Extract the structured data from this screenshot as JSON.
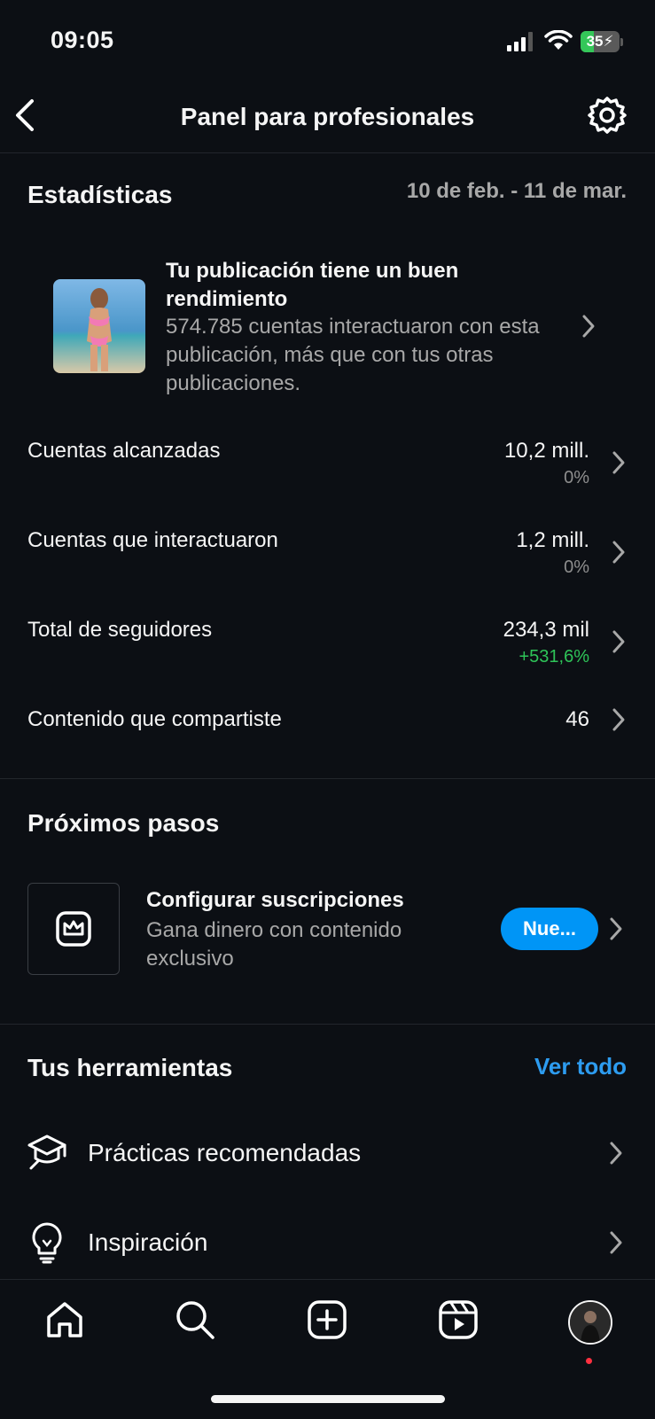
{
  "status_bar": {
    "time": "09:05",
    "battery": "35",
    "battery_level": 0.35
  },
  "header": {
    "title": "Panel para profesionales"
  },
  "stats": {
    "heading": "Estadísticas",
    "date_range": "10 de feb. - 11 de mar.",
    "featured_post": {
      "title": "Tu publicación tiene un buen rendimiento",
      "description": "574.785 cuentas interactuaron con esta publicación, más que con tus otras publicaciones."
    },
    "rows": [
      {
        "label": "Cuentas alcanzadas",
        "value": "10,2 mill.",
        "change": "0%"
      },
      {
        "label": "Cuentas que interactuaron",
        "value": "1,2 mill.",
        "change": "0%"
      },
      {
        "label": "Total de seguidores",
        "value": "234,3 mil",
        "change": "+531,6%"
      },
      {
        "label": "Contenido que compartiste",
        "value": "46"
      }
    ]
  },
  "next_steps": {
    "heading": "Próximos pasos",
    "card": {
      "title": "Configurar suscripciones",
      "description": "Gana dinero con contenido exclusivo",
      "badge": "Nue..."
    }
  },
  "tools": {
    "heading": "Tus herramientas",
    "see_all": "Ver todo",
    "items": [
      {
        "label": "Prácticas recomendadas",
        "icon": "graduation-cap-icon"
      },
      {
        "label": "Inspiración",
        "icon": "lightbulb-icon"
      }
    ]
  },
  "nav": {
    "items": [
      "home-icon",
      "search-icon",
      "create-icon",
      "reels-icon",
      "profile-avatar"
    ]
  },
  "colors": {
    "accent": "#0095f6",
    "positive": "#2ec458",
    "background": "#0c0f14"
  }
}
